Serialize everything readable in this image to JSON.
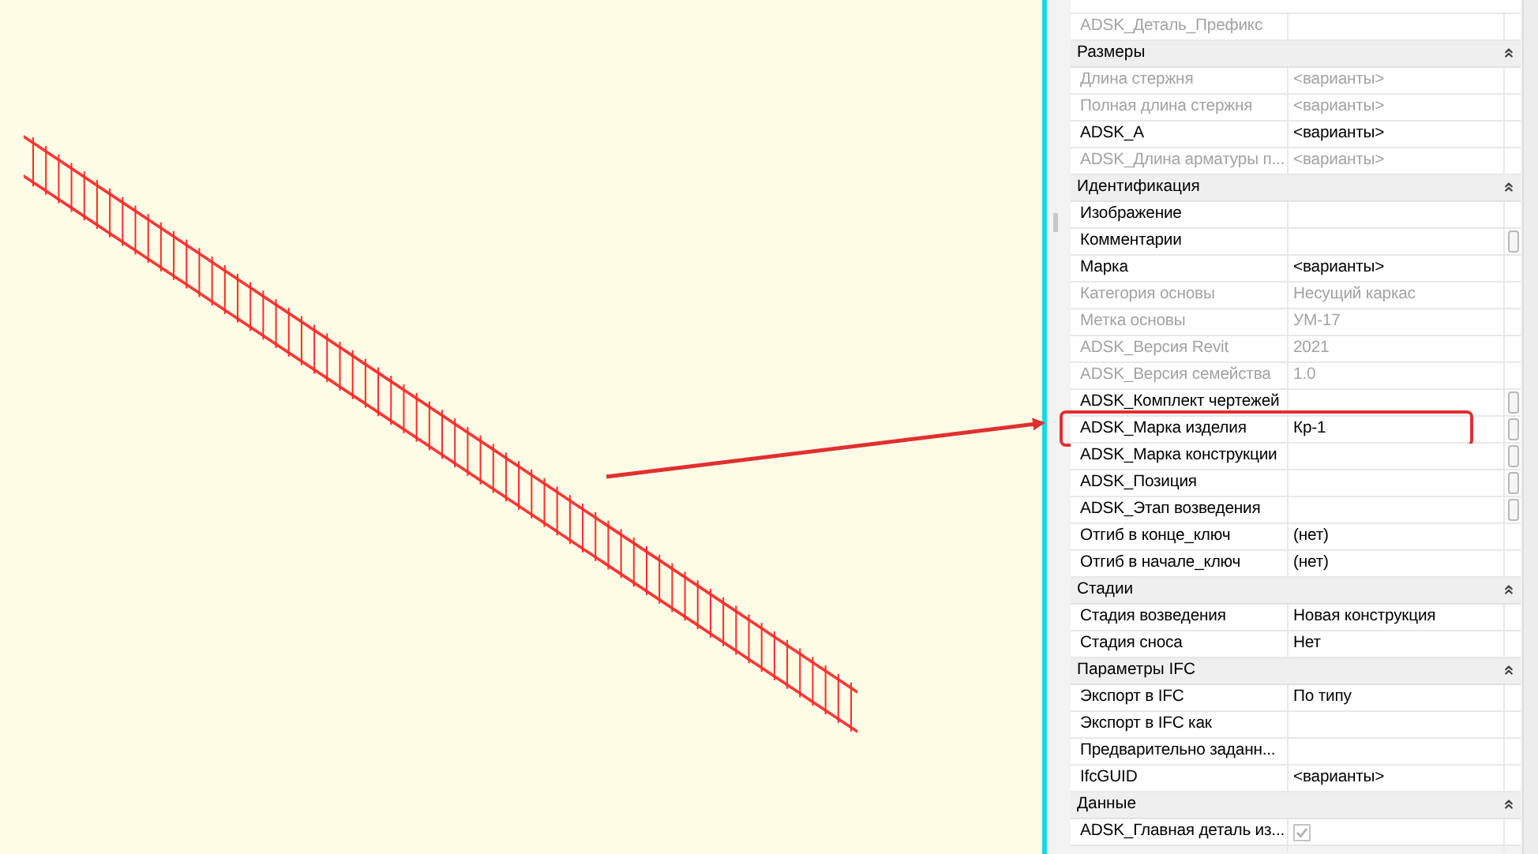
{
  "properties": {
    "sections": [
      {
        "rows": [
          {
            "name": "ADSK_Деталь_Префикс",
            "disabled": true,
            "kind": "text"
          }
        ]
      },
      {
        "title": "Размеры",
        "expanded": true,
        "rows": [
          {
            "name": "Длина стержня",
            "value": "<варианты>",
            "disabled": true,
            "kind": "text"
          },
          {
            "name": "Полная длина стержня",
            "value": "<варианты>",
            "disabled": true,
            "kind": "text"
          },
          {
            "name": "ADSK_A",
            "value": "<варианты>",
            "disabled": false,
            "kind": "text"
          },
          {
            "name": "ADSK_Длина арматуры п...",
            "value": "<варианты>",
            "disabled": true,
            "kind": "text"
          }
        ]
      },
      {
        "title": "Идентификация",
        "expanded": true,
        "rows": [
          {
            "name": "Изображение",
            "disabled": false,
            "kind": "text"
          },
          {
            "name": "Комментарии",
            "disabled": false,
            "kind": "text",
            "edit_button": true
          },
          {
            "name": "Марка",
            "value": "<варианты>",
            "disabled": false,
            "kind": "text"
          },
          {
            "name": "Категория основы",
            "value": "Несущий каркас",
            "disabled": true,
            "kind": "text"
          },
          {
            "name": "Метка основы",
            "value": "УМ-17",
            "disabled": true,
            "kind": "text"
          },
          {
            "name": "ADSK_Версия Revit",
            "value": "2021",
            "disabled": true,
            "kind": "text"
          },
          {
            "name": "ADSK_Версия семейства",
            "value": "1.0",
            "disabled": true,
            "kind": "text"
          },
          {
            "name": "ADSK_Комплект чертежей",
            "disabled": false,
            "kind": "text",
            "edit_button": true
          },
          {
            "name": "ADSK_Марка изделия",
            "value": "Кр-1",
            "disabled": false,
            "kind": "text",
            "edit_button": true,
            "highlighted": true
          },
          {
            "name": "ADSK_Марка конструкции",
            "disabled": false,
            "kind": "text",
            "edit_button": true
          },
          {
            "name": "ADSK_Позиция",
            "disabled": false,
            "kind": "text",
            "edit_button": true
          },
          {
            "name": "ADSK_Этап возведения",
            "disabled": false,
            "kind": "text",
            "edit_button": true
          },
          {
            "name": "Отгиб в конце_ключ",
            "value": "(нет)",
            "disabled": false,
            "kind": "text"
          },
          {
            "name": "Отгиб в начале_ключ",
            "value": "(нет)",
            "disabled": false,
            "kind": "text"
          }
        ]
      },
      {
        "title": "Стадии",
        "expanded": true,
        "rows": [
          {
            "name": "Стадия возведения",
            "value": "Новая конструкция",
            "disabled": false,
            "kind": "text"
          },
          {
            "name": "Стадия сноса",
            "value": "Нет",
            "disabled": false,
            "kind": "text"
          }
        ]
      },
      {
        "title": "Параметры IFC",
        "expanded": true,
        "rows": [
          {
            "name": "Экспорт в IFC",
            "value": "По типу",
            "disabled": false,
            "kind": "text"
          },
          {
            "name": "Экспорт в IFC как",
            "disabled": false,
            "kind": "text"
          },
          {
            "name": "Предварительно заданн...",
            "disabled": false,
            "kind": "text"
          },
          {
            "name": "IfcGUID",
            "value": "<варианты>",
            "disabled": false,
            "kind": "text"
          }
        ]
      },
      {
        "title": "Данные",
        "expanded": true,
        "rows": [
          {
            "name": "ADSK_Главная деталь из...",
            "disabled": false,
            "kind": "checkbox",
            "checked": true,
            "readonly": true
          }
        ]
      }
    ]
  }
}
